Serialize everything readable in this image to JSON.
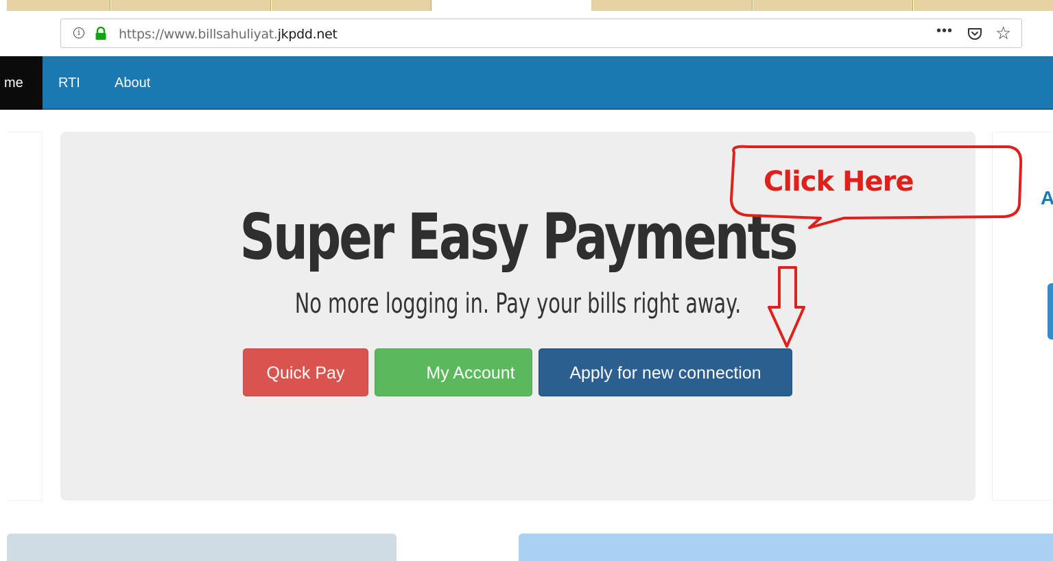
{
  "browser": {
    "url_prefix": "https://www.billsahuliyat.",
    "url_domain": "jkpdd.net",
    "info_glyph": "i",
    "menu_dots": "•••",
    "star_glyph": "☆",
    "icons": [
      "info-icon",
      "lock-icon",
      "page-actions-icon",
      "pocket-icon",
      "bookmark-star-icon"
    ]
  },
  "nav": {
    "home_label": "me",
    "items": [
      {
        "label": "RTI"
      },
      {
        "label": "About"
      }
    ]
  },
  "hero": {
    "title": "Super Easy Payments",
    "subtitle": "No more logging in. Pay your bills right away.",
    "buttons": [
      {
        "label": "Quick Pay",
        "color": "#d9534f"
      },
      {
        "label": "My Account",
        "color": "#5cb85c"
      },
      {
        "label": "Apply for new connection",
        "color": "#2a5f8f"
      }
    ]
  },
  "side_right": {
    "partial_text": "A"
  },
  "annotation": {
    "callout_text": "Click Here",
    "color": "#e0201b"
  },
  "colors": {
    "nav_bg": "#1a79b0",
    "hero_bg": "#eeeeee"
  }
}
